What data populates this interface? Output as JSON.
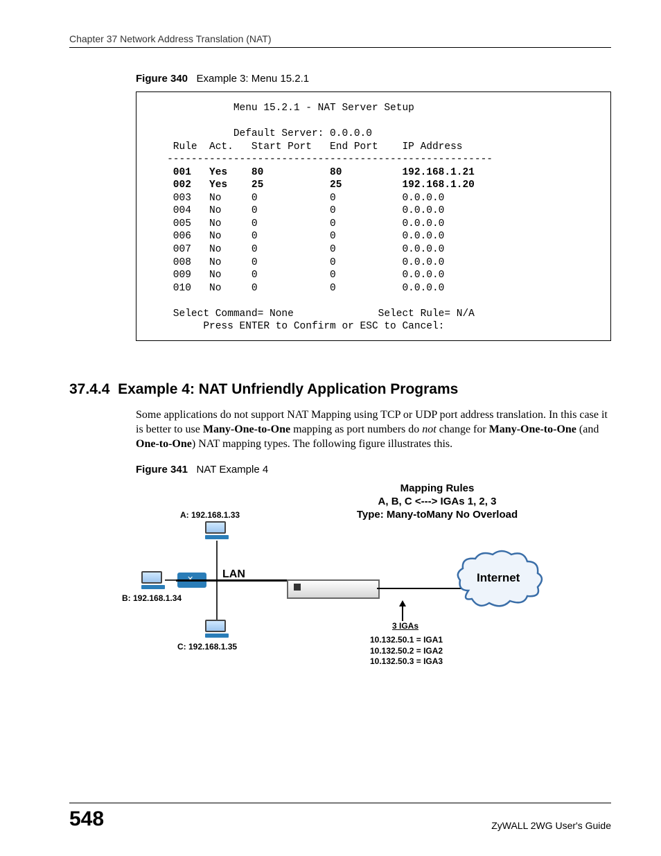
{
  "header": {
    "running": "Chapter 37 Network Address Translation (NAT)"
  },
  "figure340": {
    "label": "Figure 340",
    "caption": "Example 3: Menu 15.2.1",
    "menu_title": "Menu 15.2.1 - NAT Server Setup",
    "default_server": "Default Server: 0.0.0.0",
    "columns": "    Rule  Act.   Start Port   End Port    IP Address",
    "separator": "   ------------------------------------------------------",
    "rows": [
      {
        "rule": "001",
        "act": "Yes",
        "sp": "80",
        "ep": "80",
        "ip": "192.168.1.21",
        "bold": true
      },
      {
        "rule": "002",
        "act": "Yes",
        "sp": "25",
        "ep": "25",
        "ip": "192.168.1.20",
        "bold": true
      },
      {
        "rule": "003",
        "act": "No",
        "sp": "0",
        "ep": "0",
        "ip": "0.0.0.0",
        "bold": false
      },
      {
        "rule": "004",
        "act": "No",
        "sp": "0",
        "ep": "0",
        "ip": "0.0.0.0",
        "bold": false
      },
      {
        "rule": "005",
        "act": "No",
        "sp": "0",
        "ep": "0",
        "ip": "0.0.0.0",
        "bold": false
      },
      {
        "rule": "006",
        "act": "No",
        "sp": "0",
        "ep": "0",
        "ip": "0.0.0.0",
        "bold": false
      },
      {
        "rule": "007",
        "act": "No",
        "sp": "0",
        "ep": "0",
        "ip": "0.0.0.0",
        "bold": false
      },
      {
        "rule": "008",
        "act": "No",
        "sp": "0",
        "ep": "0",
        "ip": "0.0.0.0",
        "bold": false
      },
      {
        "rule": "009",
        "act": "No",
        "sp": "0",
        "ep": "0",
        "ip": "0.0.0.0",
        "bold": false
      },
      {
        "rule": "010",
        "act": "No",
        "sp": "0",
        "ep": "0",
        "ip": "0.0.0.0",
        "bold": false
      }
    ],
    "select_cmd": "Select Command= None",
    "select_rule": "Select Rule= N/A",
    "press_enter": "Press ENTER to Confirm or ESC to Cancel:"
  },
  "section": {
    "number": "37.4.4",
    "title": "Example 4: NAT Unfriendly Application Programs",
    "para_parts": {
      "t1": "Some applications do not support NAT Mapping using TCP or UDP port address translation. In this case it is better to use ",
      "b1": "Many-One-to-One",
      "t2": " mapping as port numbers do ",
      "i1": "not",
      "t3": " change for ",
      "b2": "Many-One-to-One",
      "t4": " (and ",
      "b3": "One-to-One",
      "t5": ") NAT mapping types. The following figure illustrates this."
    }
  },
  "figure341": {
    "label": "Figure 341",
    "caption": "NAT Example 4",
    "title_line1": "Mapping Rules",
    "title_line2": "A, B, C <---> IGAs 1, 2, 3",
    "title_line3": "Type: Many-toMany No Overload",
    "hostA": "A: 192.168.1.33",
    "hostB": "B: 192.168.1.34",
    "hostC": "C: 192.168.1.35",
    "lan": "LAN",
    "internet": "Internet",
    "igas_label": "3 IGAs",
    "iga1": "10.132.50.1 = IGA1",
    "iga2": "10.132.50.2 = IGA2",
    "iga3": "10.132.50.3 = IGA3"
  },
  "footer": {
    "page": "548",
    "guide": "ZyWALL 2WG User's Guide"
  }
}
